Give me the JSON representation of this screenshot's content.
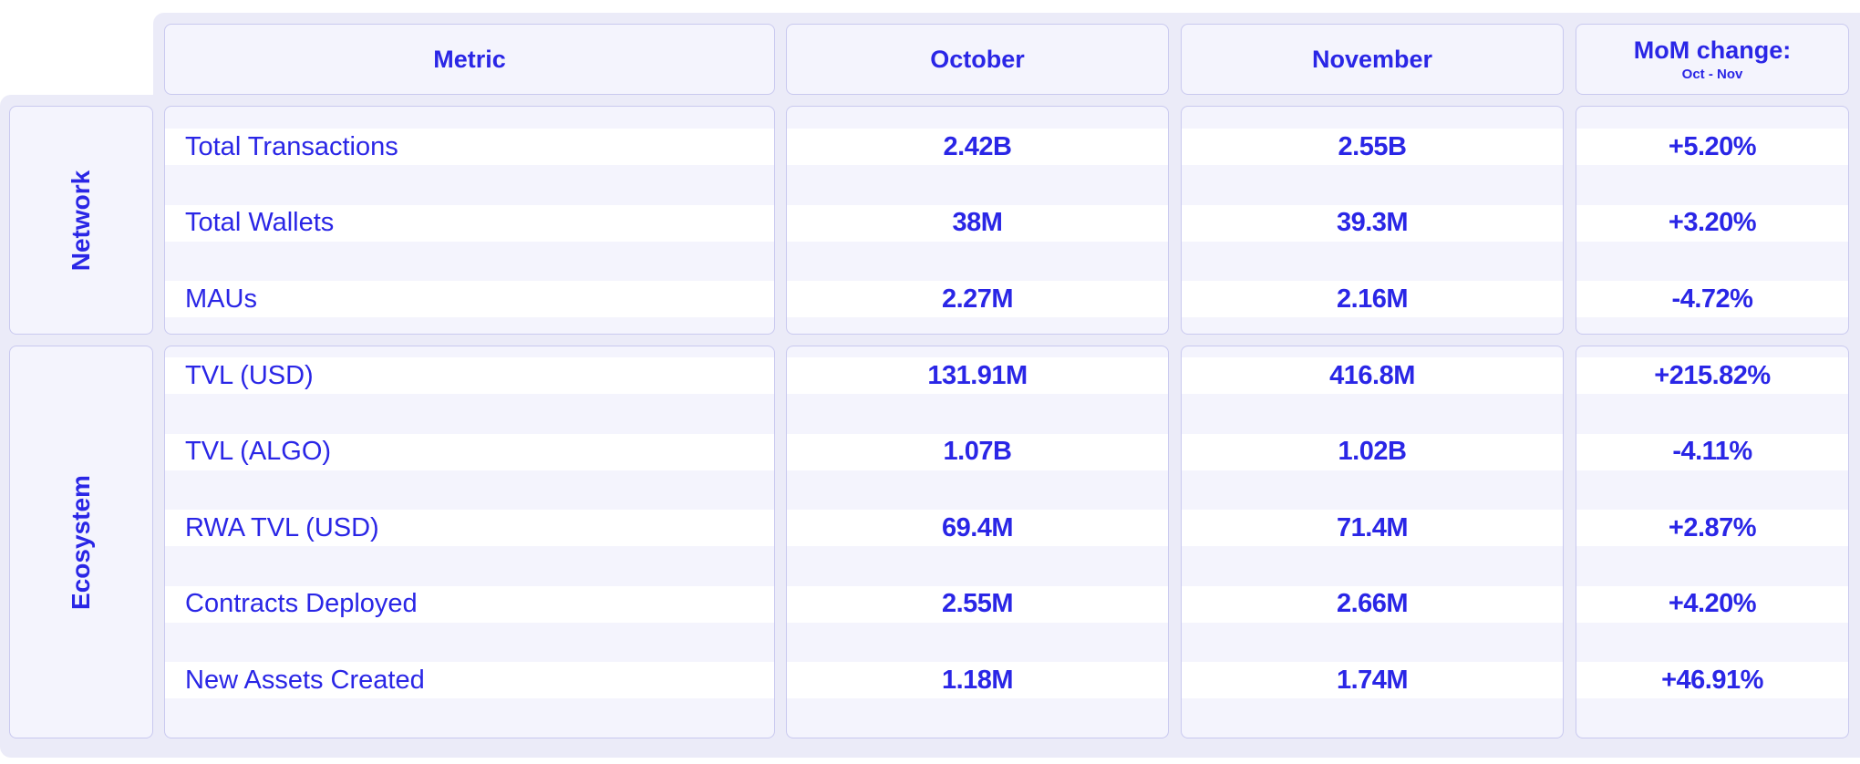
{
  "headers": {
    "metric": "Metric",
    "october": "October",
    "november": "November",
    "mom": "MoM change:",
    "mom_sub": "Oct - Nov"
  },
  "groups": [
    {
      "label": "Network",
      "rows": [
        {
          "metric": "Total Transactions",
          "october": "2.42B",
          "november": "2.55B",
          "mom": "+5.20%"
        },
        {
          "metric": "Total Wallets",
          "october": "38M",
          "november": "39.3M",
          "mom": "+3.20%"
        },
        {
          "metric": "MAUs",
          "october": "2.27M",
          "november": "2.16M",
          "mom": "-4.72%"
        }
      ]
    },
    {
      "label": "Ecosystem",
      "rows": [
        {
          "metric": "TVL (USD)",
          "october": "131.91M",
          "november": "416.8M",
          "mom": "+215.82%"
        },
        {
          "metric": "TVL (ALGO)",
          "october": "1.07B",
          "november": "1.02B",
          "mom": "-4.11%"
        },
        {
          "metric": "RWA TVL (USD)",
          "october": "69.4M",
          "november": "71.4M",
          "mom": "+2.87%"
        },
        {
          "metric": "Contracts Deployed",
          "october": "2.55M",
          "november": "2.66M",
          "mom": "+4.20%"
        },
        {
          "metric": "New Assets Created",
          "october": "1.18M",
          "november": "1.74M",
          "mom": "+46.91%"
        }
      ]
    }
  ],
  "colors": {
    "accent": "#2a26e6",
    "background": "#ebebf8",
    "panel": "#f4f4fd",
    "band": "#ffffff",
    "border": "#c9c9ef"
  },
  "chart_data": {
    "type": "table",
    "columns": [
      "Metric",
      "October",
      "November",
      "MoM change: Oct - Nov"
    ],
    "rows": [
      [
        "Total Transactions",
        "2.42B",
        "2.55B",
        "+5.20%"
      ],
      [
        "Total Wallets",
        "38M",
        "39.3M",
        "+3.20%"
      ],
      [
        "MAUs",
        "2.27M",
        "2.16M",
        "-4.72%"
      ],
      [
        "TVL (USD)",
        "131.91M",
        "416.8M",
        "+215.82%"
      ],
      [
        "TVL (ALGO)",
        "1.07B",
        "1.02B",
        "-4.11%"
      ],
      [
        "RWA TVL (USD)",
        "69.4M",
        "71.4M",
        "+2.87%"
      ],
      [
        "Contracts Deployed",
        "2.55M",
        "2.66M",
        "+4.20%"
      ],
      [
        "New Assets Created",
        "1.18M",
        "1.74M",
        "+46.91%"
      ]
    ]
  }
}
